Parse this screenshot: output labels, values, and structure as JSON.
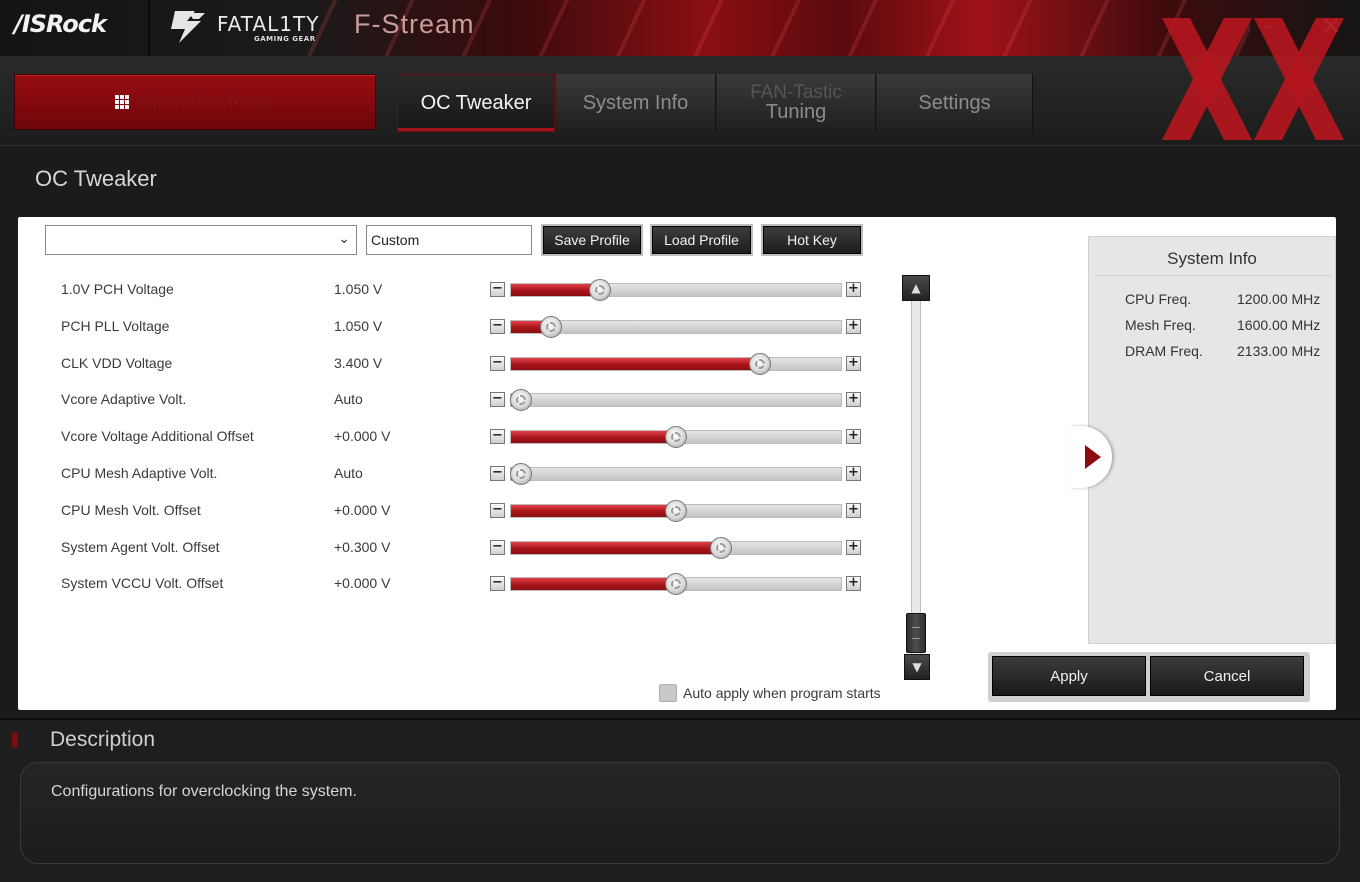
{
  "titlebar": {
    "brand": "/ISRock",
    "fatality_text": "FATAL1TY",
    "fatality_sub": "GAMING GEAR",
    "app_title": "F-Stream",
    "minimize_glyph": "–",
    "close_glyph": "×"
  },
  "nav": {
    "operation_mode": "Operation Mode",
    "tabs": [
      {
        "label": "OC Tweaker",
        "active": true
      },
      {
        "label": "System Info",
        "active": false
      },
      {
        "label_line1": "FAN-Tastic",
        "label_line2": "Tuning",
        "active": false
      },
      {
        "label": "Settings",
        "active": false
      }
    ]
  },
  "page": {
    "title": "OC Tweaker"
  },
  "profile": {
    "selected": "",
    "name": "Custom",
    "save_label": "Save Profile",
    "load_label": "Load Profile",
    "hotkey_label": "Hot Key"
  },
  "settings": [
    {
      "name": "1.0V PCH Voltage",
      "value": "1.050 V",
      "level": 0.27
    },
    {
      "name": "PCH PLL Voltage",
      "value": "1.050 V",
      "level": 0.12
    },
    {
      "name": "CLK VDD Voltage",
      "value": "3.400 V",
      "level": 0.755
    },
    {
      "name": "Vcore Adaptive Volt.",
      "value": "Auto",
      "level": 0.03
    },
    {
      "name": "Vcore Voltage Additional Offset",
      "value": "+0.000 V",
      "level": 0.5
    },
    {
      "name": "CPU Mesh Adaptive Volt.",
      "value": "Auto",
      "level": 0.03
    },
    {
      "name": "CPU Mesh Volt. Offset",
      "value": "+0.000 V",
      "level": 0.5
    },
    {
      "name": "System Agent Volt. Offset",
      "value": "+0.300 V",
      "level": 0.635
    },
    {
      "name": "System VCCU Volt. Offset",
      "value": "+0.000 V",
      "level": 0.5
    }
  ],
  "auto_apply": {
    "label": "Auto apply when program starts",
    "checked": false
  },
  "system_info": {
    "title": "System Info",
    "rows": [
      {
        "key": "CPU Freq.",
        "value": "1200.00 MHz"
      },
      {
        "key": "Mesh Freq.",
        "value": "1600.00 MHz"
      },
      {
        "key": "DRAM Freq.",
        "value": "2133.00 MHz"
      }
    ]
  },
  "actions": {
    "apply": "Apply",
    "cancel": "Cancel"
  },
  "description": {
    "title": "Description",
    "text": "Configurations for overclocking the system."
  },
  "colors": {
    "accent_red": "#a0141a",
    "watermark_red": "#b4161e"
  }
}
